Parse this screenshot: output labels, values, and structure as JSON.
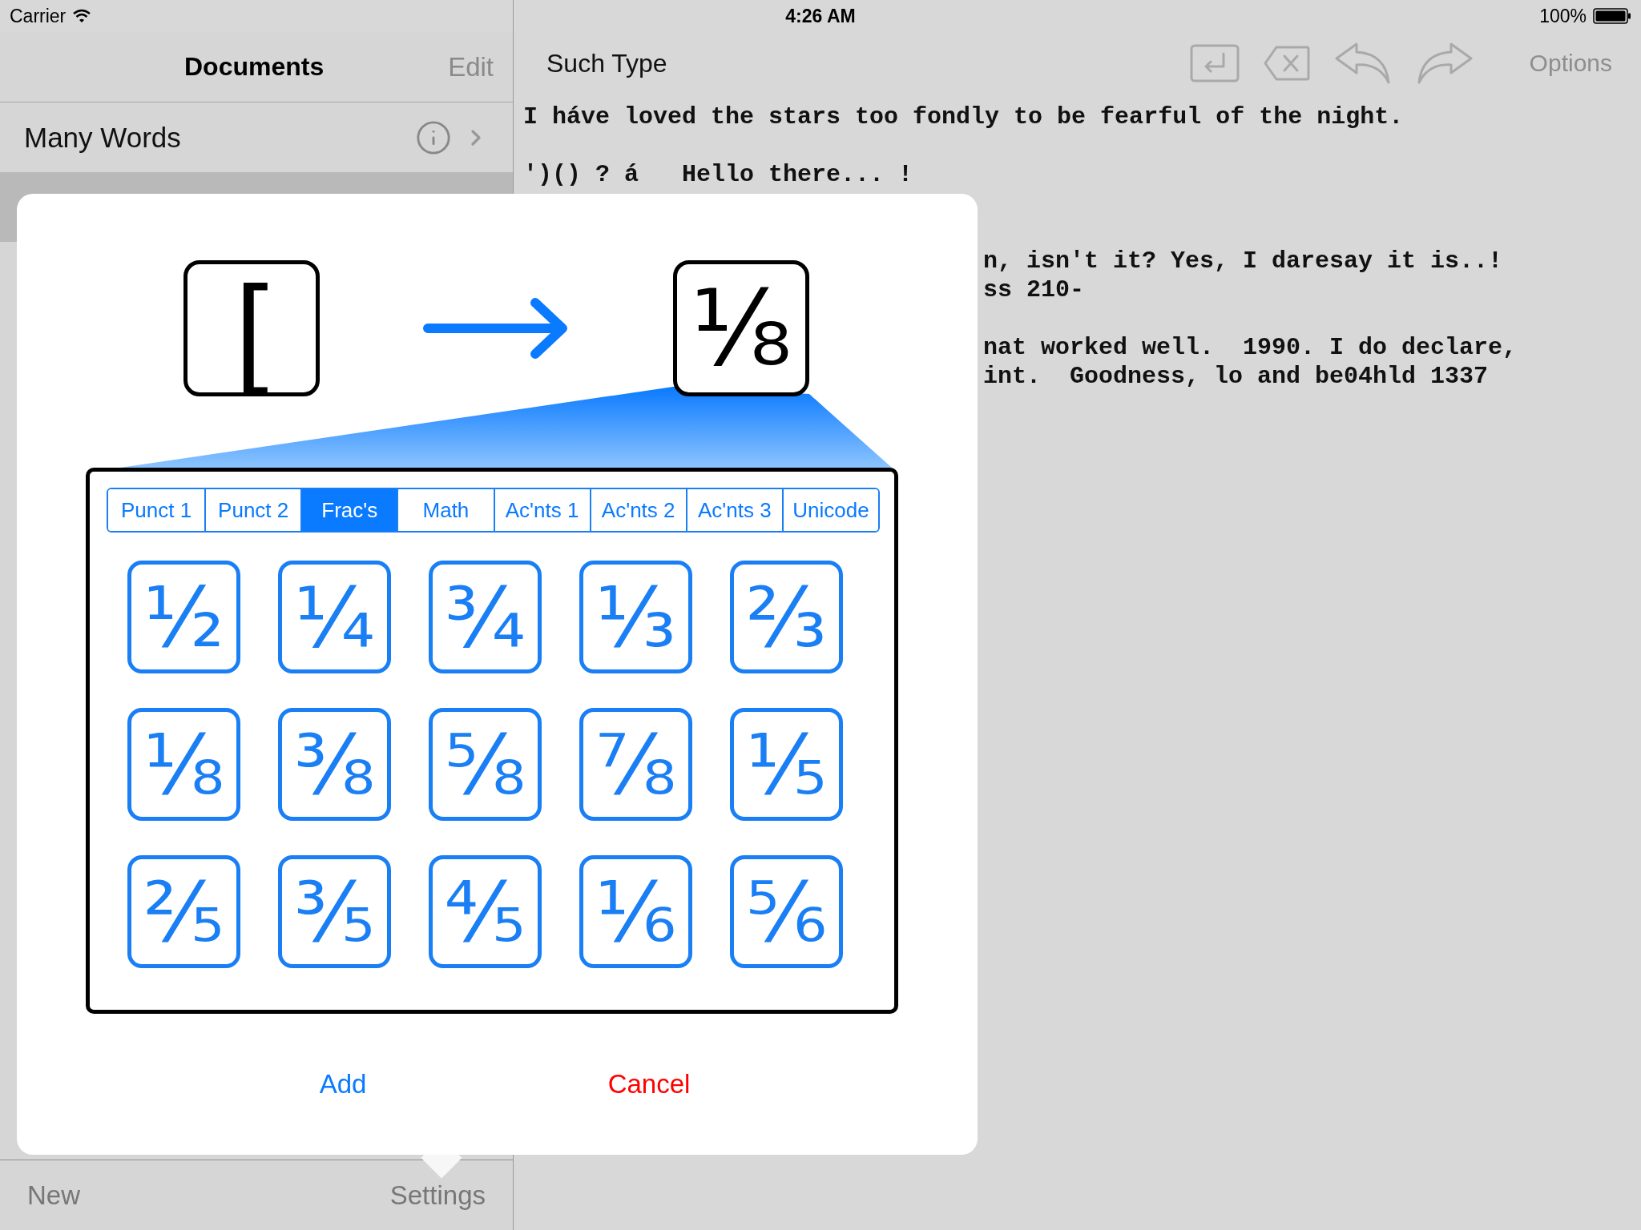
{
  "status_bar": {
    "carrier": "Carrier",
    "time": "4:26 AM",
    "battery": "100%"
  },
  "sidebar": {
    "title": "Documents",
    "edit": "Edit",
    "items": [
      {
        "name": "Many Words",
        "selected": false
      },
      {
        "selected": true
      }
    ],
    "toolbar": [
      "New",
      "Settings"
    ]
  },
  "editor": {
    "title": "Such Type",
    "options": "Options",
    "paragraphs": [
      [
        "I háve loved the stars too fondly to be fearful of the night."
      ],
      [
        "')() ? á   Hello there... !"
      ]
    ],
    "covered_paragraphs": [
      [
        "n, isn't it? Yes, I daresay it is..!",
        "ss 210-"
      ],
      [
        "nat worked well.  1990. I do declare,",
        "int.  Goodness, lo and be04hld 1337"
      ]
    ]
  },
  "popover": {
    "source_key": "[",
    "target_key": "⅛",
    "tabs": [
      {
        "label": "Punct 1",
        "selected": false
      },
      {
        "label": "Punct 2",
        "selected": false
      },
      {
        "label": "Frac's",
        "selected": true
      },
      {
        "label": "Math",
        "selected": false
      },
      {
        "label": "Ac'nts 1",
        "selected": false
      },
      {
        "label": "Ac'nts 2",
        "selected": false
      },
      {
        "label": "Ac'nts 3",
        "selected": false
      },
      {
        "label": "Unicode",
        "selected": false
      }
    ],
    "keys": [
      "½",
      "¼",
      "¾",
      "⅓",
      "⅔",
      "⅛",
      "⅜",
      "⅝",
      "⅞",
      "⅕",
      "⅖",
      "⅗",
      "⅘",
      "⅙",
      "⅚"
    ],
    "buttons": [
      {
        "label": "Add",
        "kind": "default"
      },
      {
        "label": "Cancel",
        "kind": "destructive"
      }
    ]
  }
}
